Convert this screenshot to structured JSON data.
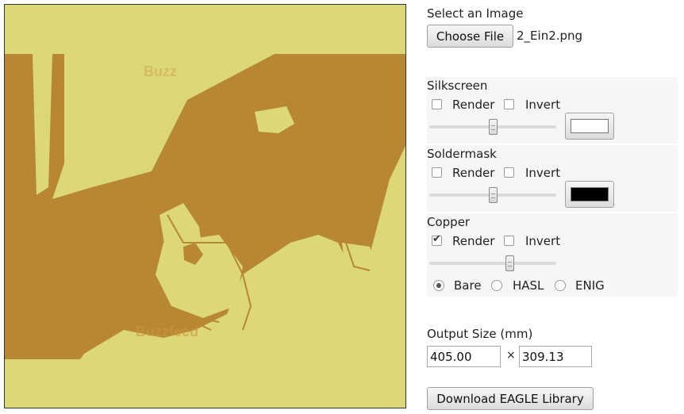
{
  "file_picker": {
    "title": "Select an Image",
    "button_label": "Choose File",
    "file_name": "2_Ein2.png"
  },
  "preview": {
    "watermark_top": "Buzz",
    "watermark_bottom": "Buzzfeed",
    "colors": {
      "background": "#dcd87a",
      "copper": "#b78733",
      "border": "#333333"
    }
  },
  "layers": {
    "silkscreen": {
      "title": "Silkscreen",
      "render_label": "Render",
      "render_checked": false,
      "invert_label": "Invert",
      "invert_checked": false,
      "threshold_fraction": 0.5,
      "color": "#ffffff"
    },
    "soldermask": {
      "title": "Soldermask",
      "render_label": "Render",
      "render_checked": false,
      "invert_label": "Invert",
      "invert_checked": false,
      "threshold_fraction": 0.5,
      "color": "#000000"
    },
    "copper": {
      "title": "Copper",
      "render_label": "Render",
      "render_checked": true,
      "invert_label": "Invert",
      "invert_checked": false,
      "threshold_fraction": 0.63,
      "finishes": [
        "Bare",
        "HASL",
        "ENIG"
      ],
      "selected_finish": "Bare"
    }
  },
  "output": {
    "title": "Output Size (mm)",
    "width": "405.00",
    "times_symbol": "×",
    "height": "309.13"
  },
  "download_button": "Download EAGLE Library"
}
